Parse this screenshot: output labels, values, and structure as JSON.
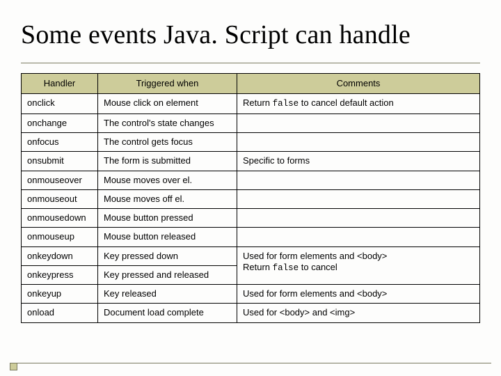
{
  "title": "Some events Java. Script can handle",
  "table": {
    "headers": [
      "Handler",
      "Triggered when",
      "Comments"
    ],
    "rows": [
      {
        "handler": "onclick",
        "trigger": "Mouse click on element",
        "comment_pre": "Return ",
        "comment_code": "false",
        "comment_post": " to cancel default action"
      },
      {
        "handler": "onchange",
        "trigger": "The control's state changes",
        "comment_pre": "",
        "comment_code": "",
        "comment_post": ""
      },
      {
        "handler": "onfocus",
        "trigger": "The control gets focus",
        "comment_pre": "",
        "comment_code": "",
        "comment_post": ""
      },
      {
        "handler": "onsubmit",
        "trigger": "The form is submitted",
        "comment_pre": "Specific to forms",
        "comment_code": "",
        "comment_post": ""
      },
      {
        "handler": "onmouseover",
        "trigger": "Mouse moves over el.",
        "comment_pre": "",
        "comment_code": "",
        "comment_post": ""
      },
      {
        "handler": "onmouseout",
        "trigger": "Mouse moves off el.",
        "comment_pre": "",
        "comment_code": "",
        "comment_post": ""
      },
      {
        "handler": "onmousedown",
        "trigger": "Mouse button pressed",
        "comment_pre": "",
        "comment_code": "",
        "comment_post": ""
      },
      {
        "handler": "onmouseup",
        "trigger": "Mouse button released",
        "comment_pre": "",
        "comment_code": "",
        "comment_post": ""
      },
      {
        "handler": "onkeydown",
        "trigger": "Key pressed down",
        "comment_pre": "Used for form elements and <body>\nReturn ",
        "comment_code": "false",
        "comment_post": " to cancel"
      },
      {
        "handler": "onkeypress",
        "trigger": "Key pressed and released",
        "comment_pre": "",
        "comment_code": "",
        "comment_post": ""
      },
      {
        "handler": "onkeyup",
        "trigger": "Key released",
        "comment_pre": "Used for form elements and <body>",
        "comment_code": "",
        "comment_post": ""
      },
      {
        "handler": "onload",
        "trigger": "Document load complete",
        "comment_pre": "Used for <body> and <img>",
        "comment_code": "",
        "comment_post": ""
      }
    ],
    "merged_comment_rows": [
      [
        8,
        9
      ]
    ]
  }
}
